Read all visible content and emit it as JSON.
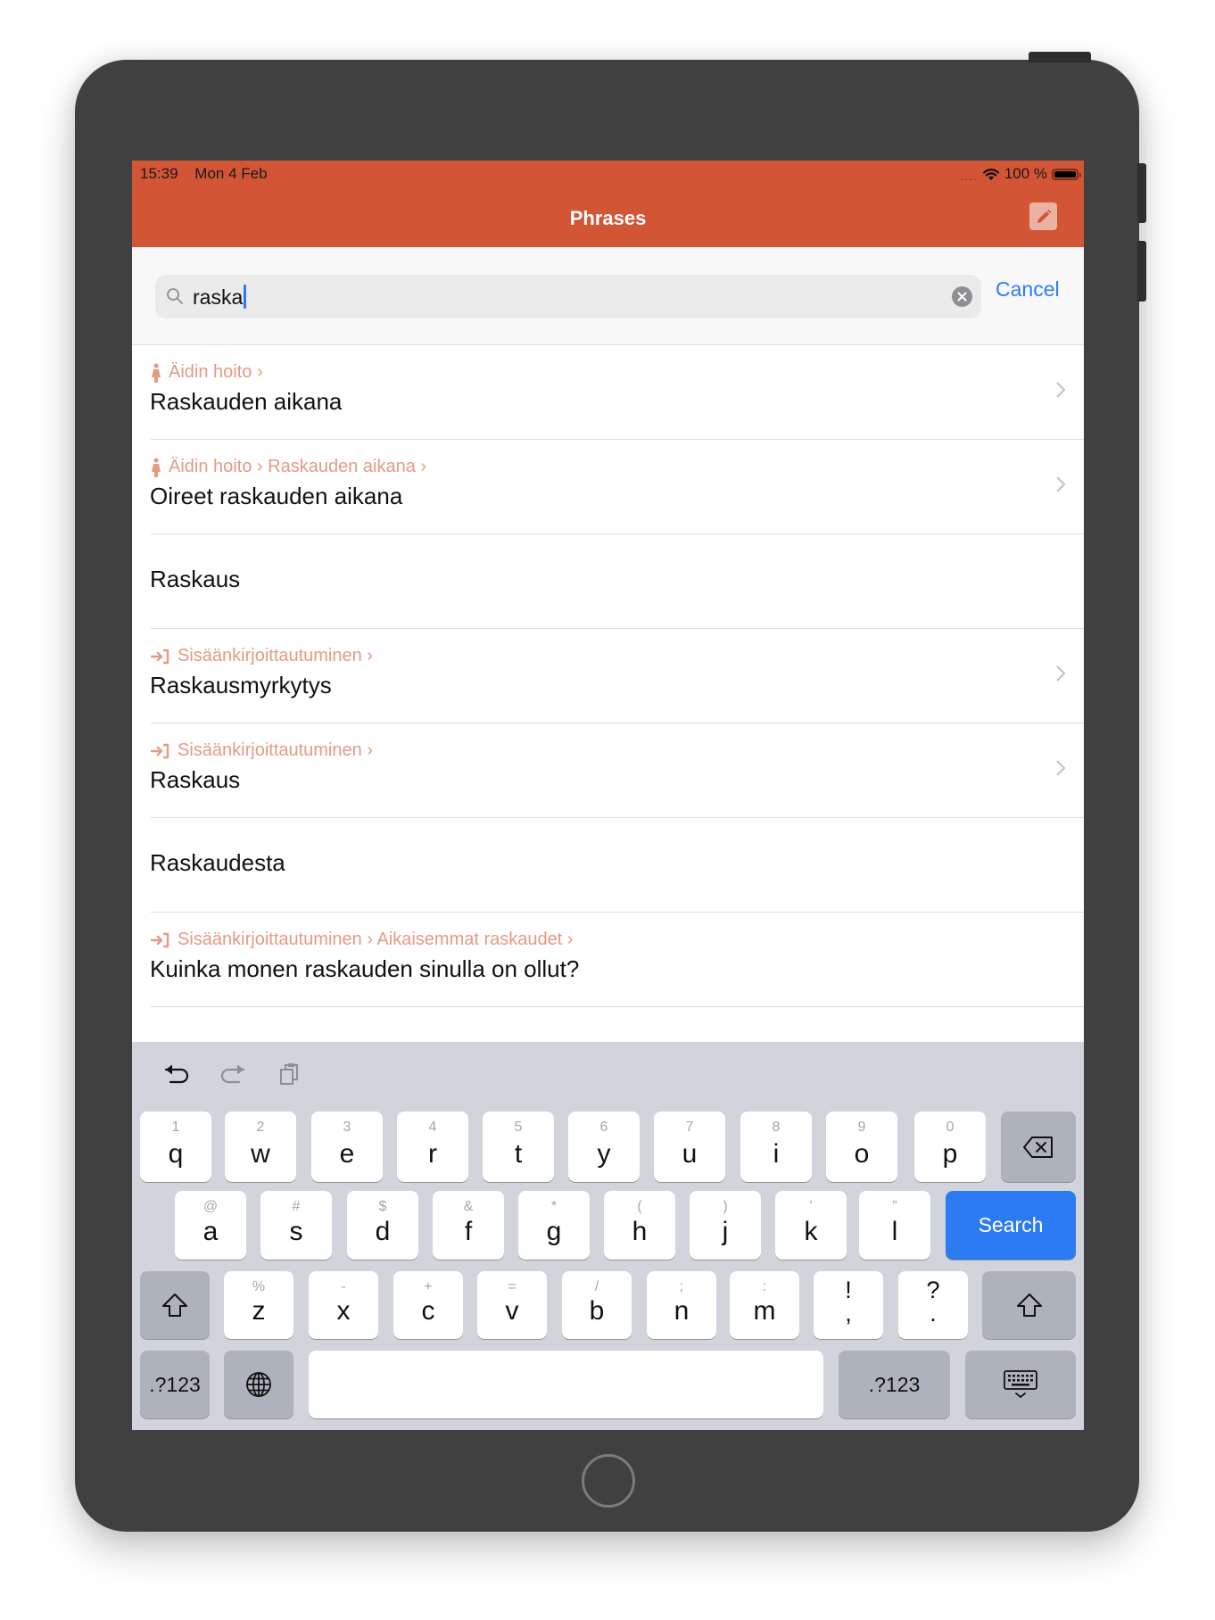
{
  "status_bar": {
    "time": "15:39",
    "date": "Mon 4 Feb",
    "signal": "....",
    "battery_percent": "100 %",
    "battery_level": 1.0
  },
  "nav": {
    "title": "Phrases",
    "edit_icon": "pencil-icon"
  },
  "search": {
    "value": "raska",
    "cancel_label": "Cancel"
  },
  "results": [
    {
      "icon": "pregnant-woman-icon",
      "breadcrumb": "Äidin hoito ›",
      "title": "Raskauden aikana",
      "has_chevron": true
    },
    {
      "icon": "pregnant-woman-icon",
      "breadcrumb": "Äidin hoito › Raskauden aikana ›",
      "title": "Oireet raskauden aikana",
      "has_chevron": true
    },
    {
      "icon": null,
      "breadcrumb": null,
      "title": "Raskaus",
      "has_chevron": false
    },
    {
      "icon": "sign-in-icon",
      "breadcrumb": "Sisäänkirjoittautuminen ›",
      "title": "Raskausmyrkytys",
      "has_chevron": true
    },
    {
      "icon": "sign-in-icon",
      "breadcrumb": "Sisäänkirjoittautuminen ›",
      "title": "Raskaus",
      "has_chevron": true
    },
    {
      "icon": null,
      "breadcrumb": null,
      "title": "Raskaudesta",
      "has_chevron": false
    },
    {
      "icon": "sign-in-icon",
      "breadcrumb": "Sisäänkirjoittautuminen › Aikaisemmat raskaudet ›",
      "title": "Kuinka monen raskauden sinulla on ollut?",
      "has_chevron": false
    }
  ],
  "keyboard": {
    "toolbar": [
      "undo-icon",
      "redo-icon",
      "paste-icon"
    ],
    "row1": [
      {
        "main": "q",
        "hint": "1"
      },
      {
        "main": "w",
        "hint": "2"
      },
      {
        "main": "e",
        "hint": "3"
      },
      {
        "main": "r",
        "hint": "4"
      },
      {
        "main": "t",
        "hint": "5"
      },
      {
        "main": "y",
        "hint": "6"
      },
      {
        "main": "u",
        "hint": "7"
      },
      {
        "main": "i",
        "hint": "8"
      },
      {
        "main": "o",
        "hint": "9"
      },
      {
        "main": "p",
        "hint": "0"
      }
    ],
    "row2": [
      {
        "main": "a",
        "hint": "@"
      },
      {
        "main": "s",
        "hint": "#"
      },
      {
        "main": "d",
        "hint": "$"
      },
      {
        "main": "f",
        "hint": "&"
      },
      {
        "main": "g",
        "hint": "*"
      },
      {
        "main": "h",
        "hint": "("
      },
      {
        "main": "j",
        "hint": ")"
      },
      {
        "main": "k",
        "hint": "’"
      },
      {
        "main": "l",
        "hint": "”"
      }
    ],
    "row3": [
      {
        "main": "z",
        "hint": "%"
      },
      {
        "main": "x",
        "hint": "-"
      },
      {
        "main": "c",
        "hint": "+"
      },
      {
        "main": "v",
        "hint": "="
      },
      {
        "main": "b",
        "hint": "/"
      },
      {
        "main": "n",
        "hint": ";"
      },
      {
        "main": "m",
        "hint": ":"
      },
      {
        "main": ",",
        "hint": "!"
      },
      {
        "main": ".",
        "hint": "?"
      }
    ],
    "search_label": "Search",
    "numbers_label": ".?123",
    "numbers_label_right": ".?123",
    "space_label": ""
  },
  "colors": {
    "accent": "#D25535",
    "breadcrumb": "#E59A83",
    "link": "#2D7CF6",
    "search_key": "#2C7BF2"
  }
}
